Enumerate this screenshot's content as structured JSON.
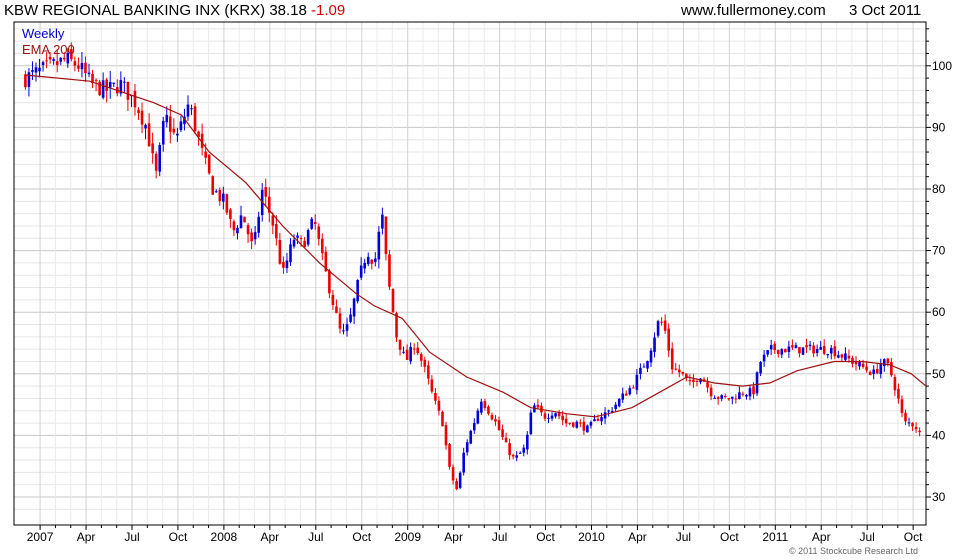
{
  "header": {
    "title": "KBW REGIONAL BANKING INX (KRX) 38.18",
    "change": "-1.09",
    "site": "www.fullermoney.com",
    "date": "3 Oct 2011"
  },
  "copyright": "© 2011 Stockcube Research Ltd",
  "chart_data": {
    "type": "candlestick",
    "title": "KBW REGIONAL BANKING INX (KRX)",
    "frequency": "Weekly",
    "last": 38.18,
    "change": -1.09,
    "ylim": [
      27,
      106
    ],
    "y_ticks": [
      30,
      40,
      50,
      60,
      70,
      80,
      90,
      100
    ],
    "x_ticks": [
      "2007",
      "Apr",
      "Jul",
      "Oct",
      "2008",
      "Apr",
      "Jul",
      "Oct",
      "2009",
      "Apr",
      "Jul",
      "Oct",
      "2010",
      "Apr",
      "Jul",
      "Oct",
      "2011",
      "Apr",
      "Jul",
      "Oct"
    ],
    "grid": true,
    "legend": [
      {
        "name": "Weekly",
        "color": "#0000cc"
      },
      {
        "name": "EMA 200",
        "color": "#a01010"
      }
    ],
    "colors": {
      "up": "#0000dd",
      "down": "#ee0000",
      "ema": "#a01010",
      "grid": "#d0d0d0"
    },
    "close_path": [
      [
        2006.9,
        98
      ],
      [
        2006.97,
        99
      ],
      [
        2007.05,
        100
      ],
      [
        2007.12,
        101
      ],
      [
        2007.19,
        100
      ],
      [
        2007.26,
        97
      ],
      [
        2007.34,
        96
      ],
      [
        2007.42,
        97
      ],
      [
        2007.5,
        94
      ],
      [
        2007.56,
        90
      ],
      [
        2007.61,
        82
      ],
      [
        2007.66,
        92
      ],
      [
        2007.72,
        88
      ],
      [
        2007.79,
        94
      ],
      [
        2007.86,
        86
      ],
      [
        2007.92,
        80
      ],
      [
        2007.98,
        78
      ],
      [
        2008.03,
        73
      ],
      [
        2008.08,
        76
      ],
      [
        2008.14,
        70
      ],
      [
        2008.19,
        80
      ],
      [
        2008.25,
        74
      ],
      [
        2008.3,
        66
      ],
      [
        2008.36,
        72
      ],
      [
        2008.41,
        71
      ],
      [
        2008.47,
        75
      ],
      [
        2008.52,
        68
      ],
      [
        2008.57,
        62
      ],
      [
        2008.62,
        56
      ],
      [
        2008.66,
        58
      ],
      [
        2008.72,
        66
      ],
      [
        2008.76,
        70
      ],
      [
        2008.8,
        68
      ],
      [
        2008.84,
        76
      ],
      [
        2008.87,
        66
      ],
      [
        2008.92,
        56
      ],
      [
        2008.97,
        52
      ],
      [
        2009.02,
        55
      ],
      [
        2009.08,
        50
      ],
      [
        2009.12,
        46
      ],
      [
        2009.17,
        42
      ],
      [
        2009.21,
        34
      ],
      [
        2009.25,
        31
      ],
      [
        2009.29,
        38
      ],
      [
        2009.34,
        42
      ],
      [
        2009.38,
        46
      ],
      [
        2009.42,
        44
      ],
      [
        2009.46,
        42
      ],
      [
        2009.52,
        38
      ],
      [
        2009.56,
        36
      ],
      [
        2009.62,
        38
      ],
      [
        2009.66,
        45
      ],
      [
        2009.72,
        43
      ],
      [
        2009.78,
        44
      ],
      [
        2009.84,
        42
      ],
      [
        2009.9,
        42
      ],
      [
        2009.96,
        41
      ],
      [
        2010.02,
        43
      ],
      [
        2010.08,
        44
      ],
      [
        2010.14,
        46
      ],
      [
        2010.2,
        48
      ],
      [
        2010.24,
        50
      ],
      [
        2010.29,
        53
      ],
      [
        2010.32,
        56
      ],
      [
        2010.35,
        59
      ],
      [
        2010.38,
        57
      ],
      [
        2010.42,
        51
      ],
      [
        2010.47,
        50
      ],
      [
        2010.52,
        48
      ],
      [
        2010.57,
        50
      ],
      [
        2010.63,
        47
      ],
      [
        2010.68,
        46
      ],
      [
        2010.74,
        46
      ],
      [
        2010.8,
        47
      ],
      [
        2010.86,
        47
      ],
      [
        2010.9,
        52
      ],
      [
        2010.96,
        54
      ],
      [
        2011.04,
        54
      ],
      [
        2011.1,
        54
      ],
      [
        2011.16,
        54
      ],
      [
        2011.22,
        54
      ],
      [
        2011.28,
        54
      ],
      [
        2011.34,
        53
      ],
      [
        2011.4,
        52
      ],
      [
        2011.46,
        51
      ],
      [
        2011.52,
        50
      ],
      [
        2011.56,
        52
      ],
      [
        2011.6,
        51
      ],
      [
        2011.64,
        47
      ],
      [
        2011.68,
        42
      ],
      [
        2011.72,
        42
      ],
      [
        2011.76,
        41
      ],
      [
        2011.78,
        38.18
      ]
    ],
    "ema_200": [
      [
        2006.9,
        98.5
      ],
      [
        2007.25,
        97.5
      ],
      [
        2007.6,
        94
      ],
      [
        2007.75,
        92
      ],
      [
        2007.9,
        86
      ],
      [
        2008.1,
        81
      ],
      [
        2008.3,
        74
      ],
      [
        2008.5,
        68
      ],
      [
        2008.7,
        63
      ],
      [
        2008.8,
        61
      ],
      [
        2008.95,
        59
      ],
      [
        2009.1,
        53.5
      ],
      [
        2009.3,
        49.5
      ],
      [
        2009.5,
        47
      ],
      [
        2009.65,
        44.5
      ],
      [
        2009.85,
        43.5
      ],
      [
        2010.0,
        43
      ],
      [
        2010.2,
        44.5
      ],
      [
        2010.35,
        47
      ],
      [
        2010.5,
        49.5
      ],
      [
        2010.65,
        48.5
      ],
      [
        2010.8,
        48
      ],
      [
        2010.95,
        48.5
      ],
      [
        2011.1,
        50.5
      ],
      [
        2011.3,
        52
      ],
      [
        2011.45,
        52
      ],
      [
        2011.6,
        51.5
      ],
      [
        2011.72,
        50
      ],
      [
        2011.8,
        48
      ]
    ]
  }
}
